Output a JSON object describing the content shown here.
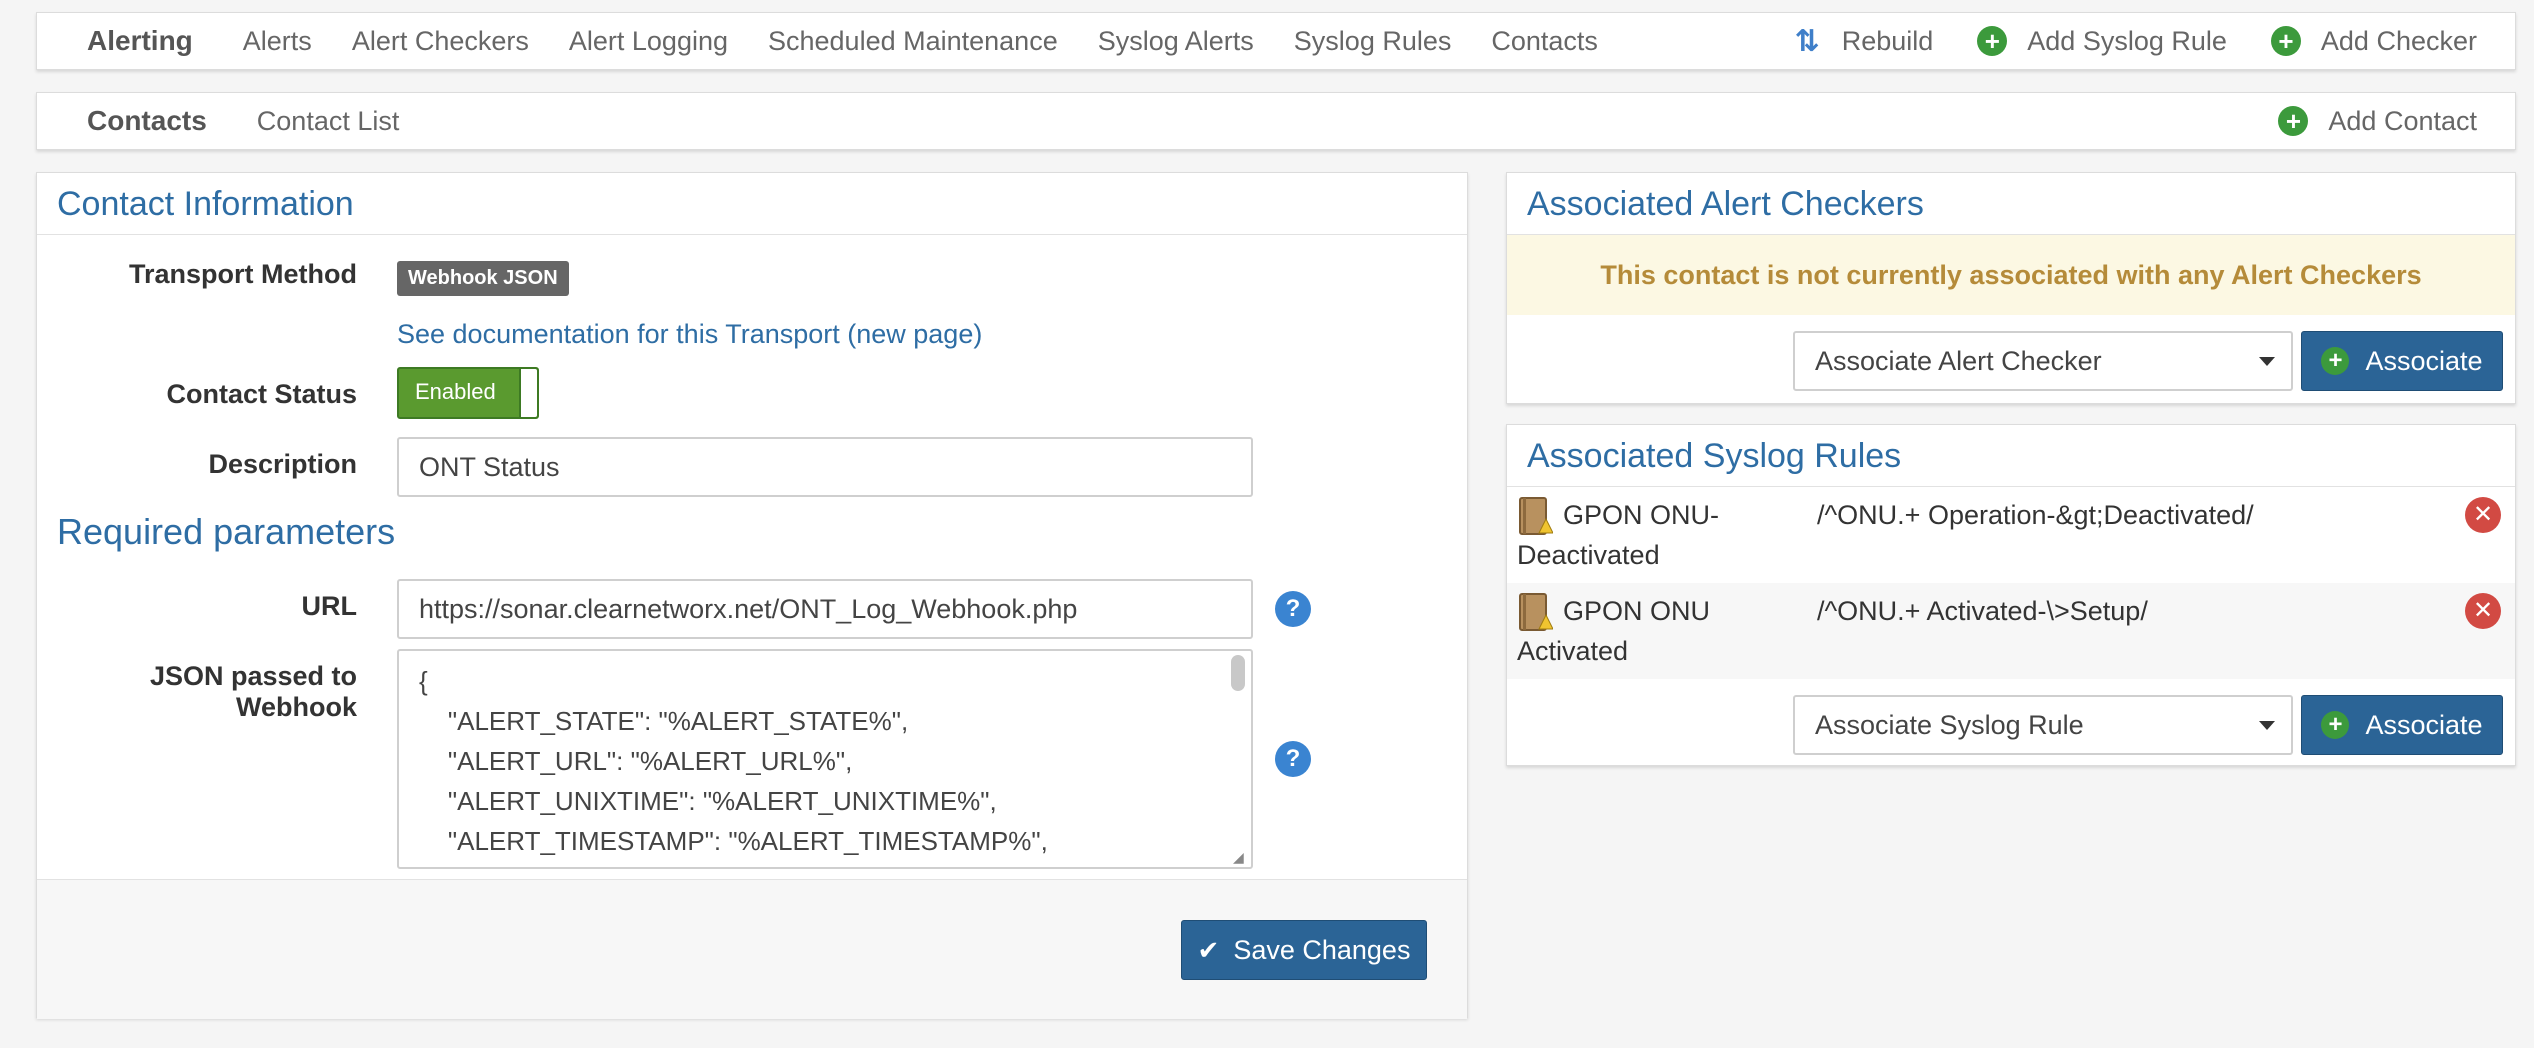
{
  "nav": {
    "brand": "Alerting",
    "items": [
      "Alerts",
      "Alert Checkers",
      "Alert Logging",
      "Scheduled Maintenance",
      "Syslog Alerts",
      "Syslog Rules",
      "Contacts"
    ],
    "actions": {
      "rebuild": "Rebuild",
      "add_syslog_rule": "Add Syslog Rule",
      "add_checker": "Add Checker"
    }
  },
  "subnav": {
    "brand": "Contacts",
    "items": [
      "Contact List"
    ],
    "add_contact": "Add Contact"
  },
  "contact": {
    "title": "Contact Information",
    "transport_label": "Transport Method",
    "transport_value": "Webhook JSON",
    "doc_link": "See documentation for this Transport (new page)",
    "status_label": "Contact Status",
    "status_value": "Enabled",
    "description_label": "Description",
    "description_value": "ONT Status",
    "required_title": "Required parameters",
    "url_label": "URL",
    "url_value": "https://sonar.clearnetworx.net/ONT_Log_Webhook.php",
    "json_label": "JSON passed to Webhook",
    "json_lines": [
      "{",
      "    \"ALERT_STATE\": \"%ALERT_STATE%\",",
      "    \"ALERT_URL\": \"%ALERT_URL%\",",
      "    \"ALERT_UNIXTIME\": \"%ALERT_UNIXTIME%\",",
      "    \"ALERT_TIMESTAMP\": \"%ALERT_TIMESTAMP%\","
    ],
    "help_glyph": "?",
    "save_label": "Save Changes"
  },
  "alert_checkers": {
    "title": "Associated Alert Checkers",
    "warning": "This contact is not currently associated with any Alert Checkers",
    "select_value": "Associate Alert Checker",
    "button": "Associate"
  },
  "syslog_rules": {
    "title": "Associated Syslog Rules",
    "rules": [
      {
        "name_line1": "GPON ONU-",
        "name_line2": "Deactivated",
        "regex": "/^ONU.+ Operation-&gt;Deactivated/"
      },
      {
        "name_line1": "GPON ONU",
        "name_line2": "Activated",
        "regex": "/^ONU.+ Activated-\\>Setup/"
      }
    ],
    "select_value": "Associate Syslog Rule",
    "button": "Associate"
  },
  "colors": {
    "accent": "#2e6da4",
    "button": "#2b6496",
    "enabled": "#5a9a2f",
    "warning_bg": "#fcf8e3",
    "warning_text": "#b58b39",
    "danger": "#d24a43"
  }
}
